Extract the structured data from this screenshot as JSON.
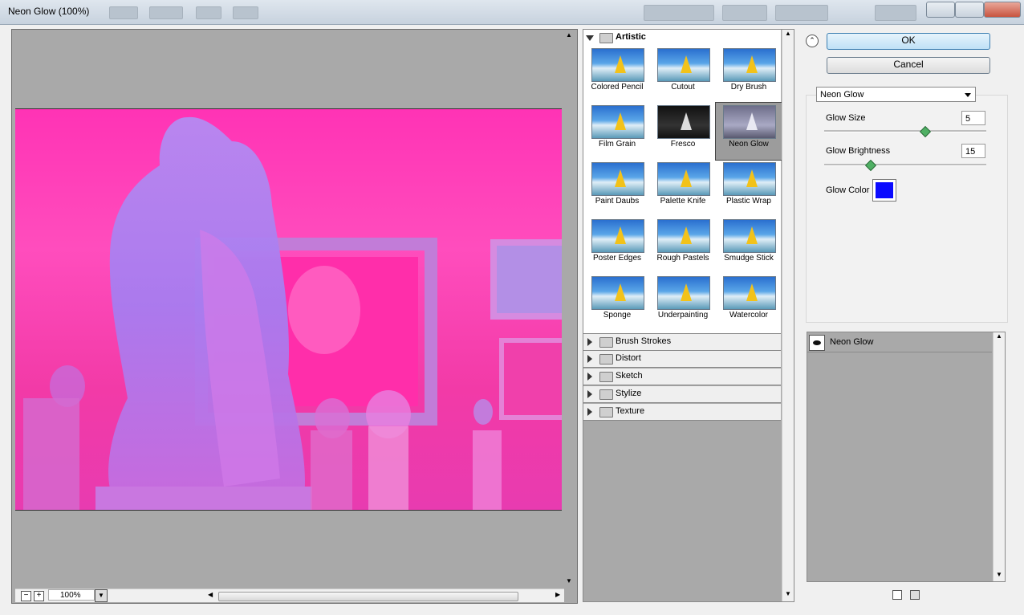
{
  "window": {
    "title": "Neon Glow (100%)"
  },
  "preview": {
    "zoom_value": "100%",
    "zoom_out_symbol": "−",
    "zoom_in_symbol": "+",
    "colors": {
      "tint": "#ff33b5",
      "figure": "#9b7cf2"
    }
  },
  "filter_browser": {
    "artistic": {
      "label": "Artistic",
      "filters": [
        {
          "label": "Colored Pencil"
        },
        {
          "label": "Cutout"
        },
        {
          "label": "Dry Brush"
        },
        {
          "label": "Film Grain"
        },
        {
          "label": "Fresco"
        },
        {
          "label": "Neon Glow",
          "selected": true
        },
        {
          "label": "Paint Daubs"
        },
        {
          "label": "Palette Knife"
        },
        {
          "label": "Plastic Wrap"
        },
        {
          "label": "Poster Edges"
        },
        {
          "label": "Rough Pastels"
        },
        {
          "label": "Smudge Stick"
        },
        {
          "label": "Sponge"
        },
        {
          "label": "Underpainting"
        },
        {
          "label": "Watercolor"
        }
      ]
    },
    "categories": [
      {
        "label": "Brush Strokes"
      },
      {
        "label": "Distort"
      },
      {
        "label": "Sketch"
      },
      {
        "label": "Stylize"
      },
      {
        "label": "Texture"
      }
    ]
  },
  "buttons": {
    "ok": "OK",
    "cancel": "Cancel"
  },
  "settings": {
    "filter_select": "Neon Glow",
    "glow_size": {
      "label": "Glow Size",
      "value": "5",
      "level": 0.62
    },
    "glow_brightness": {
      "label": "Glow Brightness",
      "value": "15",
      "level": 0.28
    },
    "glow_color": {
      "label": "Glow Color",
      "color": "#0a0aff"
    }
  },
  "layers": {
    "items": [
      {
        "label": "Neon Glow"
      }
    ]
  }
}
